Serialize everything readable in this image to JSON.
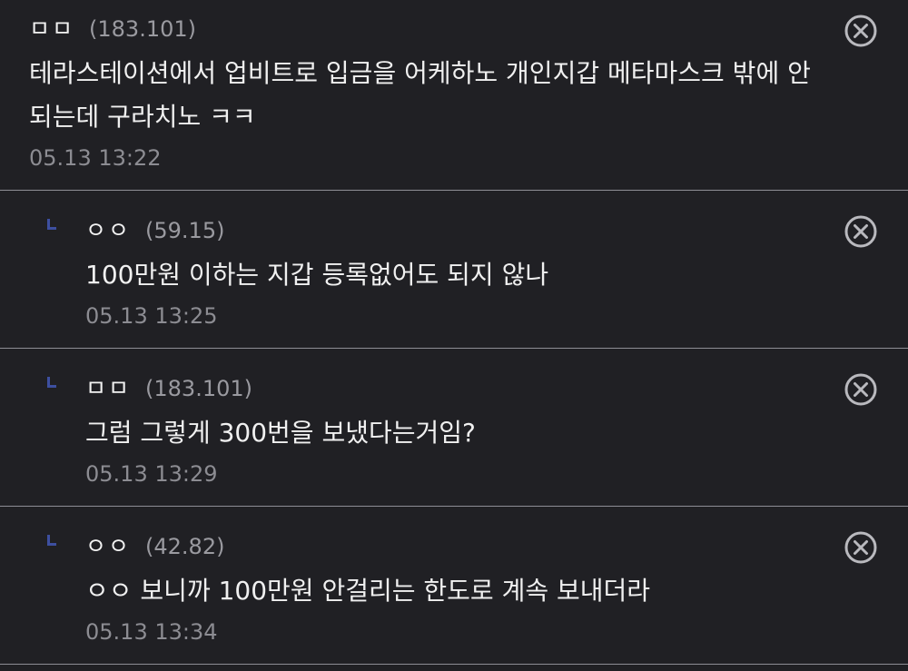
{
  "comments": [
    {
      "nick": "ㅁㅁ",
      "ip": "(183.101)",
      "text_lines": [
        "테라스테이션에서 업비트로 입금을 어케하노 개인지갑 메타마스크 밖에 안",
        "되는데 구라치노 ㅋㅋ"
      ],
      "time": "05.13 13:22",
      "reply": false
    },
    {
      "nick": "ㅇㅇ",
      "ip": "(59.15)",
      "text_lines": [
        "100만원 이하는 지갑 등록없어도 되지 않나"
      ],
      "time": "05.13 13:25",
      "reply": true
    },
    {
      "nick": "ㅁㅁ",
      "ip": "(183.101)",
      "text_lines": [
        "그럼 그렇게 300번을 보냈다는거임?"
      ],
      "time": "05.13 13:29",
      "reply": true
    },
    {
      "nick": "ㅇㅇ",
      "ip": "(42.82)",
      "text_lines": [
        "ㅇㅇ 보니까 100만원 안걸리는 한도로 계속 보내더라"
      ],
      "time": "05.13 13:34",
      "reply": true
    }
  ],
  "colors": {
    "background": "#202024",
    "divider": "#8e8e95",
    "reply_marker": "#3d4fa0",
    "delete_icon": "#b9b9be"
  },
  "icons": {
    "delete": "circle-x-icon",
    "reply": "reply-corner-icon"
  }
}
